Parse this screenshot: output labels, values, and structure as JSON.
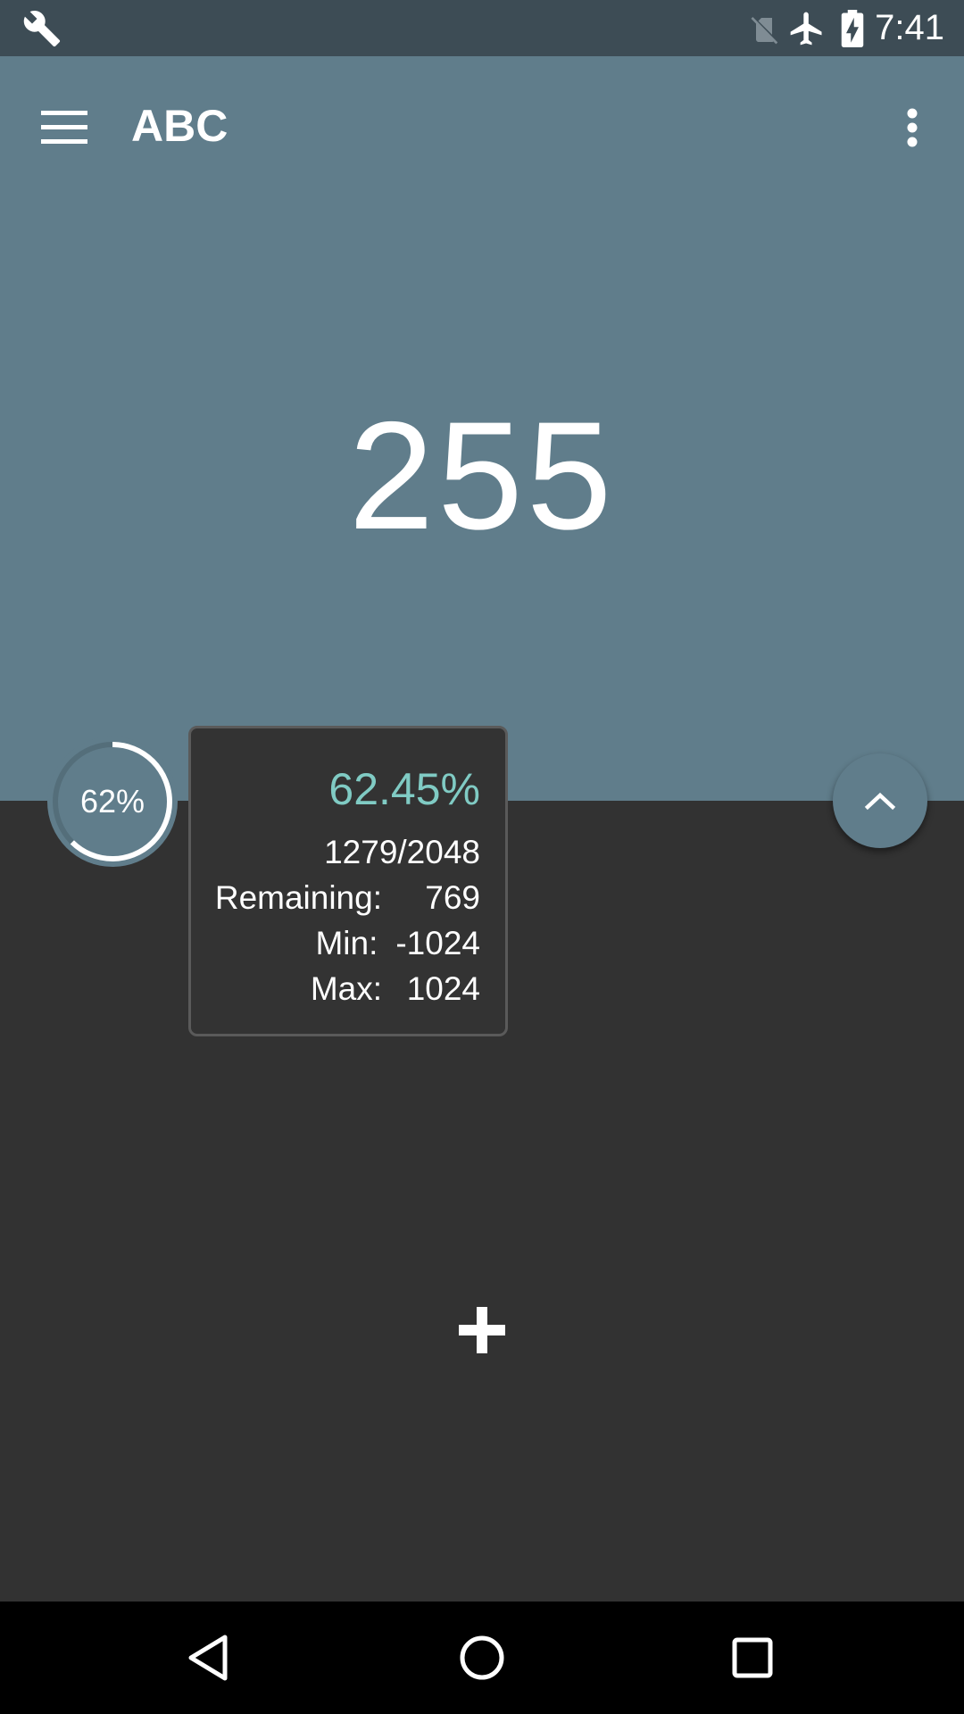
{
  "status_bar": {
    "time": "7:41",
    "icons": [
      "wrench-icon",
      "no-sim-icon",
      "airplane-mode-icon",
      "battery-charging-icon"
    ]
  },
  "app_bar": {
    "title": "ABC",
    "menu_icon": "hamburger-menu-icon",
    "overflow_icon": "more-vert-icon"
  },
  "counter": {
    "value": "255"
  },
  "progress": {
    "label": "62%",
    "fraction": 0.6245,
    "colors": {
      "track": "#546e7a",
      "fill": "#ffffff"
    }
  },
  "info_card": {
    "percent": "62.45%",
    "ratio": "1279/2048",
    "rows": [
      {
        "label": "Remaining:",
        "value": "769"
      },
      {
        "label": "Min:",
        "value": "-1024"
      },
      {
        "label": "Max:",
        "value": "1024"
      }
    ],
    "accent": "#80cbc4"
  },
  "fab": {
    "icon": "chevron-up-icon"
  },
  "add_button": {
    "icon": "plus-icon"
  },
  "nav_bar": {
    "icons": [
      "back-icon",
      "home-icon",
      "recents-icon"
    ]
  },
  "colors": {
    "primary": "#607d8b",
    "status_bar": "#3d4c55",
    "background": "#323232"
  }
}
